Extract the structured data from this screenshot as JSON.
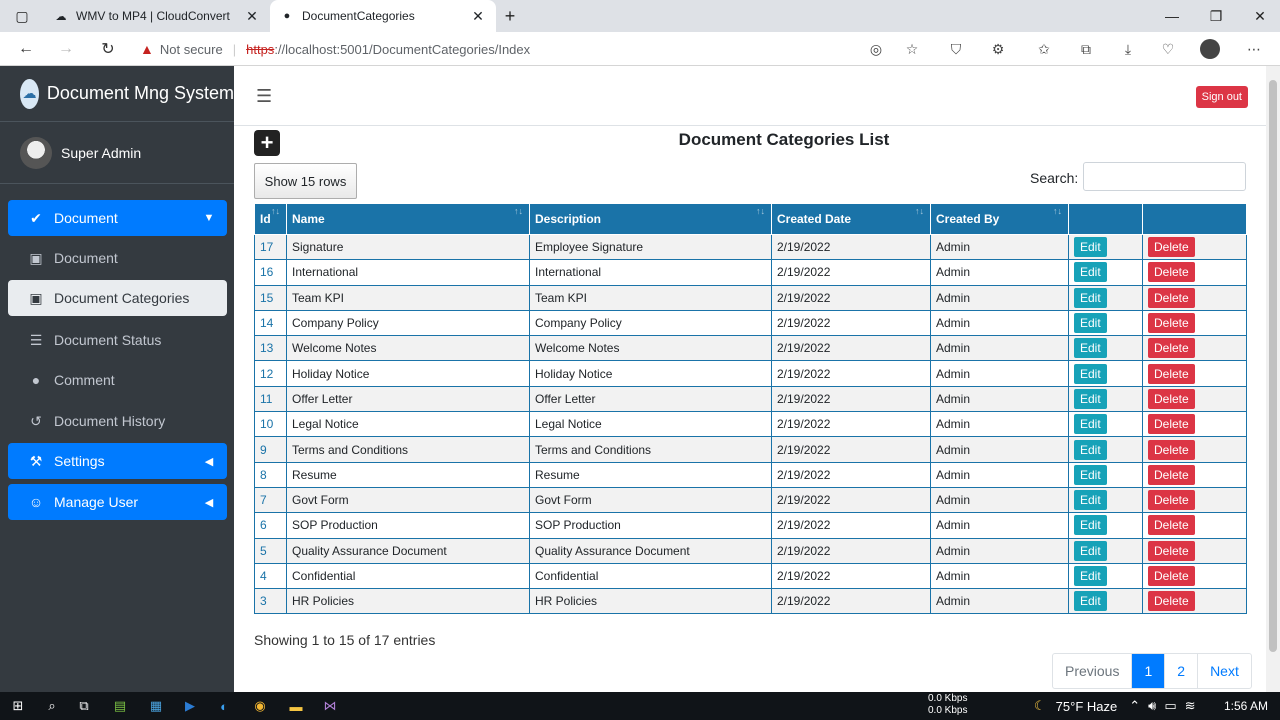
{
  "browser": {
    "tabs": [
      {
        "title": "WMV to MP4 | CloudConvert",
        "icon": "cloud-icon"
      },
      {
        "title": "DocumentCategories",
        "icon": "app-logo-icon"
      }
    ],
    "new_tab": "+",
    "security": "Not secure",
    "url_scheme": "https",
    "url_rest": "://localhost:5001/DocumentCategories/Index"
  },
  "sidebar": {
    "brand": "Document Mng System",
    "user": "Super Admin",
    "items": [
      {
        "label": "Document",
        "icon": "check-circle-icon",
        "style": "primary",
        "chevron": "down"
      },
      {
        "label": "Document",
        "icon": "money-bill-icon",
        "style": "sub"
      },
      {
        "label": "Document Categories",
        "icon": "money-bill-icon",
        "style": "sub-active"
      },
      {
        "label": "Document Status",
        "icon": "database-icon",
        "style": "sub"
      },
      {
        "label": "Comment",
        "icon": "comment-icon",
        "style": "sub"
      },
      {
        "label": "Document History",
        "icon": "history-icon",
        "style": "sub"
      },
      {
        "label": "Settings",
        "icon": "toolbox-icon",
        "style": "primary",
        "chevron": "left"
      },
      {
        "label": "Manage User",
        "icon": "users-cog-icon",
        "style": "primary",
        "chevron": "left"
      }
    ]
  },
  "topnav": {
    "signout": "Sign out"
  },
  "content": {
    "title": "Document Categories List",
    "show_rows": "Show 15 rows",
    "search_label": "Search:",
    "search_value": "",
    "columns": [
      "Id",
      "Name",
      "Description",
      "Created Date",
      "Created By",
      "",
      ""
    ],
    "edit_label": "Edit",
    "delete_label": "Delete",
    "rows": [
      {
        "id": "17",
        "name": "Signature",
        "description": "Employee Signature",
        "created": "2/19/2022",
        "by": "Admin"
      },
      {
        "id": "16",
        "name": "International",
        "description": "International",
        "created": "2/19/2022",
        "by": "Admin"
      },
      {
        "id": "15",
        "name": "Team KPI",
        "description": "Team KPI",
        "created": "2/19/2022",
        "by": "Admin"
      },
      {
        "id": "14",
        "name": "Company Policy",
        "description": "Company Policy",
        "created": "2/19/2022",
        "by": "Admin"
      },
      {
        "id": "13",
        "name": "Welcome Notes",
        "description": "Welcome Notes",
        "created": "2/19/2022",
        "by": "Admin"
      },
      {
        "id": "12",
        "name": "Holiday Notice",
        "description": "Holiday Notice",
        "created": "2/19/2022",
        "by": "Admin"
      },
      {
        "id": "11",
        "name": "Offer Letter",
        "description": "Offer Letter",
        "created": "2/19/2022",
        "by": "Admin"
      },
      {
        "id": "10",
        "name": "Legal Notice",
        "description": "Legal Notice",
        "created": "2/19/2022",
        "by": "Admin"
      },
      {
        "id": "9",
        "name": "Terms and Conditions",
        "description": "Terms and Conditions",
        "created": "2/19/2022",
        "by": "Admin"
      },
      {
        "id": "8",
        "name": "Resume",
        "description": "Resume",
        "created": "2/19/2022",
        "by": "Admin"
      },
      {
        "id": "7",
        "name": "Govt Form",
        "description": "Govt Form",
        "created": "2/19/2022",
        "by": "Admin"
      },
      {
        "id": "6",
        "name": "SOP Production",
        "description": "SOP Production",
        "created": "2/19/2022",
        "by": "Admin"
      },
      {
        "id": "5",
        "name": "Quality Assurance Document",
        "description": "Quality Assurance Document",
        "created": "2/19/2022",
        "by": "Admin"
      },
      {
        "id": "4",
        "name": "Confidential",
        "description": "Confidential",
        "created": "2/19/2022",
        "by": "Admin"
      },
      {
        "id": "3",
        "name": "HR Policies",
        "description": "HR Policies",
        "created": "2/19/2022",
        "by": "Admin"
      }
    ],
    "info": "Showing 1 to 15 of 17 entries",
    "pager": [
      "Previous",
      "1",
      "2",
      "Next"
    ],
    "pager_active": "1"
  },
  "taskbar": {
    "net_up": "0.0 Kbps",
    "net_down": "0.0 Kbps",
    "weather": "75°F  Haze",
    "time": "1:56 AM"
  },
  "colors": {
    "sidebar_bg": "#343a40",
    "primary": "#007bff",
    "table_header": "#1a73a8",
    "edit": "#17a2b8",
    "delete": "#dc3545"
  }
}
